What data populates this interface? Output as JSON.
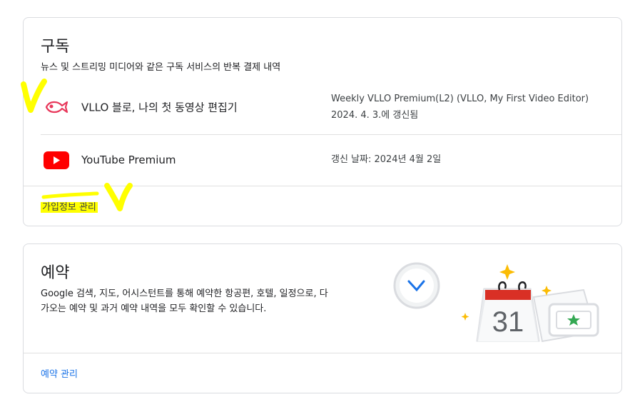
{
  "subscriptions": {
    "title": "구독",
    "description": "뉴스 및 스트리밍 미디어와 같은 구독 서비스의 반복 결제 내역",
    "items": [
      {
        "name": "VLLO 블로, 나의 첫 동영상 편집기",
        "detail_line1": "Weekly VLLO Premium(L2) (VLLO, My First Video Editor)",
        "detail_line2": "2024. 4. 3.에 갱신됨",
        "icon": "vllo-fish-icon"
      },
      {
        "name": "YouTube Premium",
        "detail_line1": "갱신 날짜: 2024년 4월 2일",
        "icon": "youtube-icon"
      }
    ],
    "manage_link": "가입정보 관리"
  },
  "reservations": {
    "title": "예약",
    "description_line1": "Google 검색, 지도, 어시스턴트를 통해 예약한 항공편, 호텔, 일정으로, 다",
    "description_line2": "가오는 예약 및 과거 예약 내역을 모두 확인할 수 있습니다.",
    "calendar_day": "31",
    "manage_link": "예약 관리"
  },
  "colors": {
    "accent_link": "#1a73e8",
    "youtube_red": "#ff0000",
    "vllo_pink": "#e8375a",
    "highlighter": "#ffff00"
  }
}
